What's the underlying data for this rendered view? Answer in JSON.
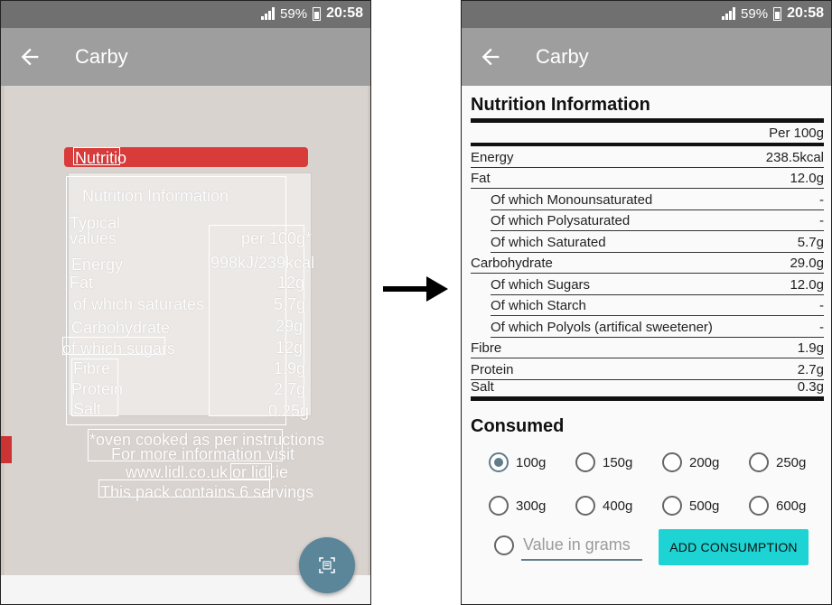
{
  "status": {
    "battery": "59%",
    "time": "20:58"
  },
  "app": {
    "title": "Carby"
  },
  "ocr": {
    "words": [
      "Nutritio",
      "Nutrition Information",
      "Typical",
      "values",
      "per 100g*",
      "Energy",
      "998kJ/239kcal",
      "Fat",
      "12g",
      "of which saturates",
      "5.7g",
      "Carbohydrate",
      "29g",
      "of which sugars",
      "12g",
      "Fibre",
      "1.9g",
      "Protein",
      "2.7g",
      "Salt",
      "0.25g",
      "*oven cooked as per instructions",
      "For more information visit",
      "www.lidl.co.uk or lidl.ie",
      "This pack contains 6 servings"
    ]
  },
  "nutrition": {
    "title": "Nutrition Information",
    "per_label": "Per 100g",
    "rows": [
      {
        "label": "Energy",
        "value": "238.5kcal",
        "indent": false
      },
      {
        "label": "Fat",
        "value": "12.0g",
        "indent": false
      },
      {
        "label": "Of which Monounsaturated",
        "value": "-",
        "indent": true
      },
      {
        "label": "Of which Polysaturated",
        "value": "-",
        "indent": true
      },
      {
        "label": "Of which Saturated",
        "value": "5.7g",
        "indent": true
      },
      {
        "label": "Carbohydrate",
        "value": "29.0g",
        "indent": false
      },
      {
        "label": "Of which Sugars",
        "value": "12.0g",
        "indent": true
      },
      {
        "label": "Of which Starch",
        "value": "-",
        "indent": true
      },
      {
        "label": "Of which Polyols (artifical sweetener)",
        "value": "-",
        "indent": true
      },
      {
        "label": "Fibre",
        "value": "1.9g",
        "indent": false
      },
      {
        "label": "Protein",
        "value": "2.7g",
        "indent": false
      },
      {
        "label": "Salt",
        "value": "0.3g",
        "indent": false
      }
    ]
  },
  "consumed": {
    "title": "Consumed",
    "options": [
      "100g",
      "150g",
      "200g",
      "250g",
      "300g",
      "400g",
      "500g",
      "600g"
    ],
    "selected": "100g",
    "placeholder": "Value in grams",
    "button": "ADD CONSUMPTION"
  },
  "colors": {
    "accent": "#1ed3d3",
    "appbar": "#9e9e9e",
    "fab": "#5b8598",
    "radio": "#607d8b"
  },
  "icons": [
    "back-arrow-icon",
    "scan-icon",
    "signal-icon",
    "battery-icon",
    "right-arrow-icon"
  ]
}
